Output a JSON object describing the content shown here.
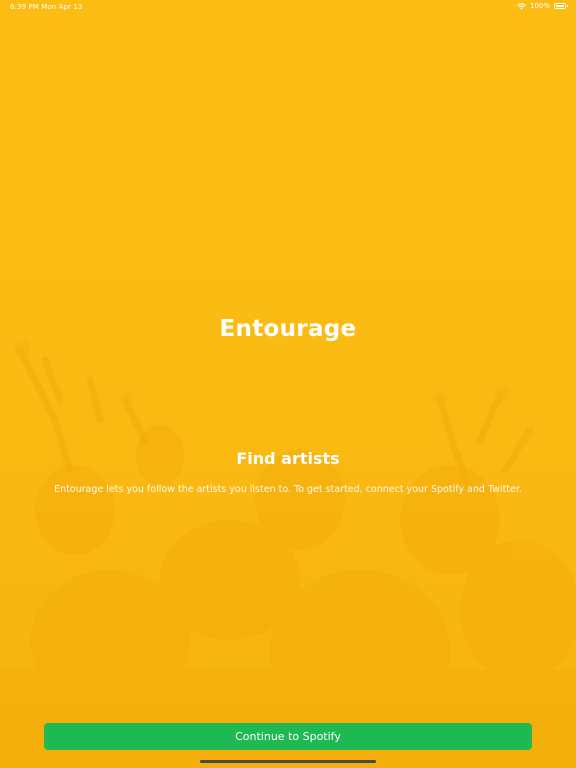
{
  "status_bar": {
    "time_date": "6:39 PM   Mon Apr 13",
    "battery": "100%",
    "icons": [
      "wifi-icon",
      "battery-icon"
    ]
  },
  "app": {
    "title": "Entourage"
  },
  "onboarding": {
    "heading": "Find artists",
    "description": "Entourage lets you follow the artists you listen to. To get started, connect your Spotify and Twitter."
  },
  "actions": {
    "continue_label": "Continue to Spotify"
  },
  "colors": {
    "background": "#fbbd14",
    "button": "#1fb953",
    "text": "#ffffff"
  }
}
